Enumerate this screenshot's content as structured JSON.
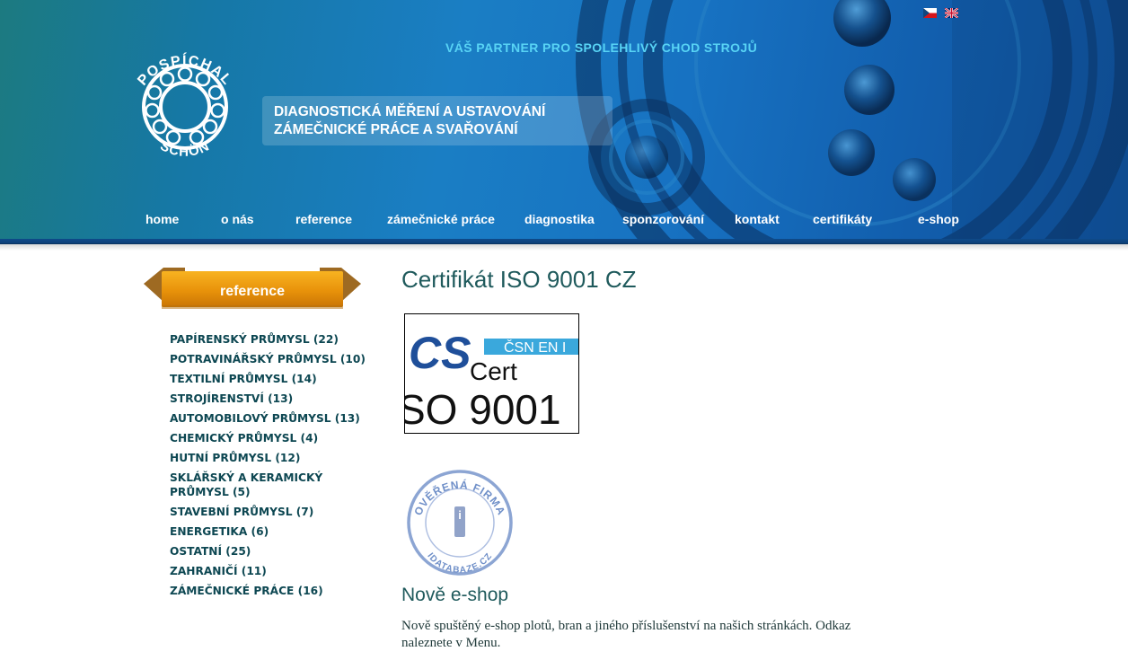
{
  "header": {
    "tagline": "VÁŠ PARTNER PRO SPOLEHLIVÝ CHOD STROJŮ",
    "services": [
      "DIAGNOSTICKÁ MĚŘENÍ A USTAVOVÁNÍ",
      "ZÁMEČNICKÉ PRÁCE A SVAŘOVÁNÍ"
    ],
    "logo_text_top": "POSPÍCHAL",
    "logo_text_bottom": "SCHÖN",
    "languages": [
      "cz-flag-icon",
      "uk-flag-icon"
    ]
  },
  "nav": [
    {
      "label": "home"
    },
    {
      "label": "o nás"
    },
    {
      "label": "reference"
    },
    {
      "label": "zámečnické práce"
    },
    {
      "label": "diagnostika"
    },
    {
      "label": "sponzorování"
    },
    {
      "label": "kontakt"
    },
    {
      "label": "certifikáty"
    },
    {
      "label": "e-shop"
    }
  ],
  "sidebar": {
    "ribbon_label": "reference",
    "categories": [
      "PAPÍRENSKÝ PRŮMYSL (22)",
      "POTRAVINÁŘSKÝ PRŮMYSL (10)",
      "TEXTILNÍ PRŮMYSL (14)",
      "STROJÍRENSTVÍ (13)",
      "AUTOMOBILOVÝ PRŮMYSL (13)",
      "CHEMICKÝ PRŮMYSL (4)",
      "HUTNÍ PRŮMYSL (12)",
      "SKLÁŘSKÝ A KERAMICKÝ PRŮMYSL (5)",
      "STAVEBNÍ PRŮMYSL (7)",
      "ENERGETIKA (6)",
      "OSTATNÍ (25)",
      "ZAHRANIČÍ (11)",
      "ZÁMEČNICKÉ PRÁCE (16)"
    ]
  },
  "main": {
    "title": "Certifikát ISO 9001 CZ",
    "cert_image": {
      "line1": "ČSN EN I",
      "cs": "CS",
      "cert": "Cert",
      "iso": "SO 9001"
    },
    "stamp": {
      "text_top": "OVĚŘENÁ FIRMA",
      "text_bottom": "IDATABAZE.CZ",
      "center": "i"
    },
    "news_title": "Nově e-shop",
    "news_text": "Nově spuštěný e-shop plotů, bran a jiného příslušenství na našich stránkách. Odkaz naleznete v Menu."
  },
  "colors": {
    "header_blue": "#1772c2",
    "tagline": "#58d4f5",
    "ribbon_orange": "#e8920a",
    "category_text": "#0d4752",
    "heading_text": "#1f5a5c"
  }
}
